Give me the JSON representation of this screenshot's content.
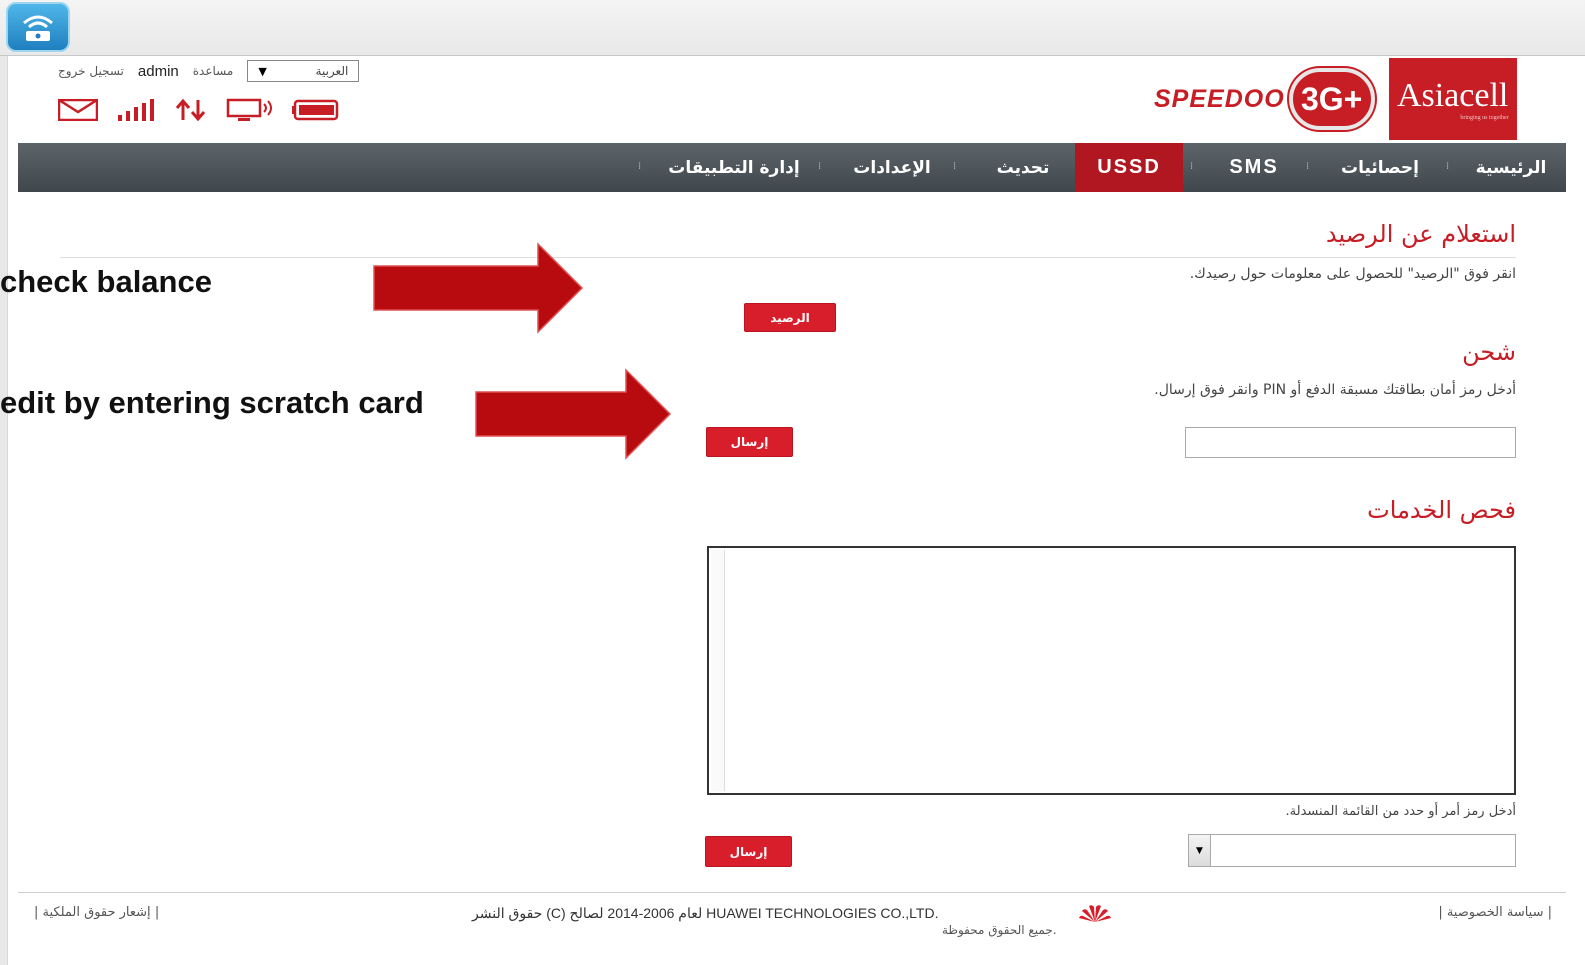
{
  "header": {
    "logout_label": "تسجيل خروج",
    "username": "admin",
    "help_label": "مساعدة",
    "language": "العربية",
    "status_icons": [
      "mail-icon",
      "signal-icon",
      "data-transfer-icon",
      "computer-icon",
      "battery-icon"
    ],
    "brand_speedoo": "SPEEDOO",
    "brand_3g": "3G+",
    "brand_asiacell": "Asiacell",
    "brand_tagline": "bringing us together"
  },
  "nav": {
    "items": [
      {
        "label": "الرئيسية"
      },
      {
        "label": "إحصائيات"
      },
      {
        "label": "SMS"
      },
      {
        "label": "USSD",
        "active": true
      },
      {
        "label": "تحديث"
      },
      {
        "label": "الإعدادات"
      },
      {
        "label": "إدارة التطبيقات"
      }
    ]
  },
  "balance": {
    "title": "استعلام عن الرصيد",
    "description": "انقر فوق \"الرصيد\" للحصول على معلومات حول رصيدك.",
    "button_label": "الرصيد"
  },
  "recharge": {
    "title": "شحن",
    "description": "أدخل رمز أمان بطاقتك مسبقة الدفع أو PIN وانقر فوق إرسال.",
    "input_value": "",
    "button_label": "إرسال"
  },
  "services": {
    "title": "فحص الخدمات",
    "response_text": "",
    "hint": "أدخل رمز أمر أو حدد من القائمة المنسدلة.",
    "select_value": "",
    "button_label": "إرسال"
  },
  "annotations": {
    "check_balance": "check balance",
    "credit": "edit by entering scratch card",
    "arrow_color": "#b80b10"
  },
  "footer": {
    "copyright_notice_link": "إشعار حقوق الملكية",
    "copyright": "حقوق النشر (C) لعام 2006-2014 لصالح HUAWEI TECHNOLOGIES CO.,LTD.",
    "rights": "جميع الحقوق محفوظة.",
    "privacy_link": "سياسة الخصوصية"
  }
}
